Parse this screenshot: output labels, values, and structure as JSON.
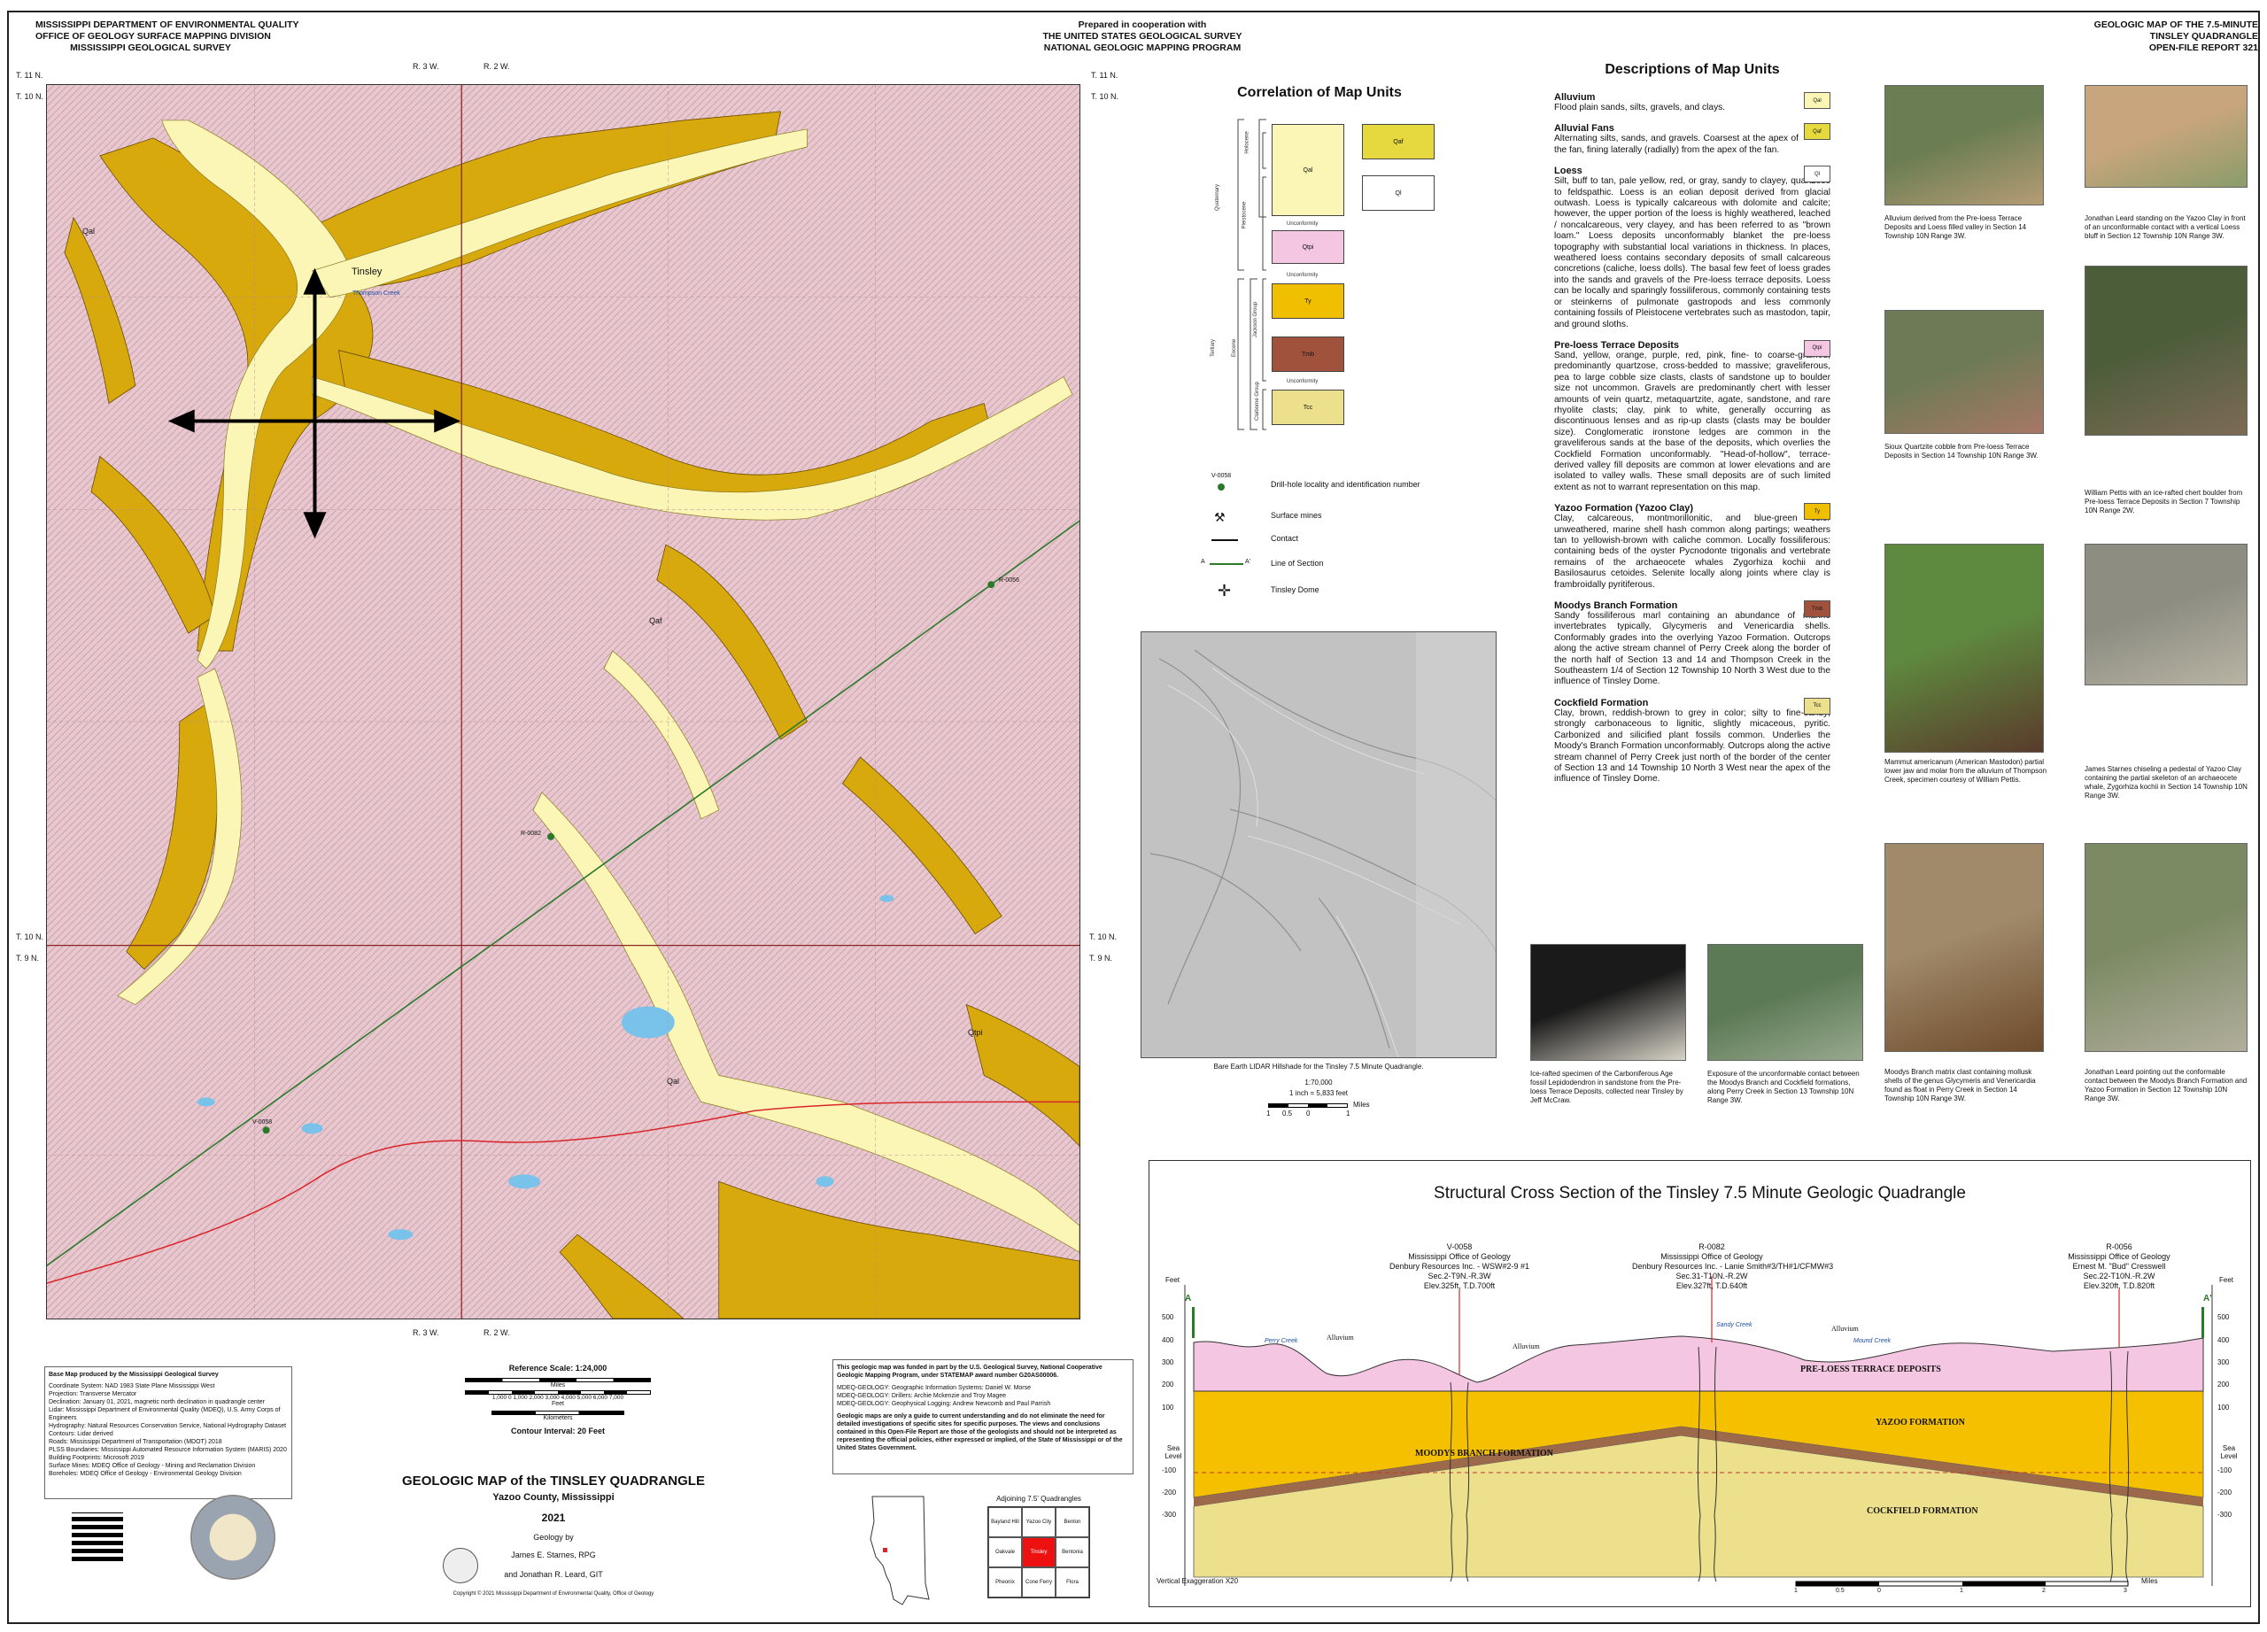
{
  "header": {
    "left": [
      "MISSISSIPPI DEPARTMENT OF ENVIRONMENTAL QUALITY",
      "OFFICE OF GEOLOGY    SURFACE MAPPING DIVISION",
      "MISSISSIPPI GEOLOGICAL SURVEY"
    ],
    "middle": [
      "Prepared in cooperation with",
      "THE UNITED STATES GEOLOGICAL SURVEY",
      "NATIONAL GEOLOGIC MAPPING PROGRAM"
    ],
    "right": [
      "GEOLOGIC MAP OF THE 7.5-MINUTE",
      "TINSLEY QUADRANGLE",
      "OPEN-FILE REPORT 321"
    ]
  },
  "map": {
    "township_labels": {
      "t11_left": "T. 11 N.",
      "t10_left": "T. 10 N.",
      "t11_right": "T. 11 N.",
      "t10_right": "T. 10 N.",
      "t10_mid_left": "T. 10 N.",
      "t9_mid_left": "T. 9 N.",
      "t10_mid_right": "T. 10 N.",
      "t9_mid_right": "T. 9 N."
    },
    "range_labels": {
      "r3_top": "R. 3 W.",
      "r2_top": "R. 2 W.",
      "r3_bottom": "R. 3 W.",
      "r2_bottom": "R. 2 W."
    },
    "place": "Tinsley",
    "creek": "Thompson Creek",
    "unit_labels": {
      "qal": "Qal",
      "qaf": "Qaf",
      "qtpi": "Qtpi"
    },
    "wells": {
      "w1": "V-0058",
      "w2": "R-0082",
      "w3": "R-0056"
    },
    "colors": {
      "loess": "#e8c7cf",
      "alluvium": "#fbf6b6",
      "terrace": "#d8a90c",
      "road": "#d9262a",
      "section_line": "#2a7a2a",
      "grid": "#8b2626"
    }
  },
  "correlation": {
    "title": "Correlation of Map Units",
    "boxes": {
      "qal": "Qal",
      "qaf": "Qaf",
      "ql": "Ql",
      "qtpi": "Qtpi",
      "ty": "Ty",
      "tmb": "Tmb",
      "tcc": "Tcc"
    },
    "unconformity": "Unconformity",
    "ages": {
      "holocene": "Holocene",
      "pleistocene": "Pleistocene",
      "quaternary": "Quaternary",
      "tertiary": "Tertiary",
      "eocene": "Eocene",
      "jackson": "Jackson Group",
      "claiborne": "Claiborne Group"
    },
    "legend": {
      "well_id": "V-0058",
      "drill": "Drill-hole locality and identification number",
      "mines": "Surface mines",
      "contact": "Contact",
      "section": "Line of Section",
      "dome": "Tinsley Dome",
      "a": "A",
      "a_prime": "A'"
    },
    "colors": {
      "qal": "#fbf6b6",
      "qaf": "#e6d83f",
      "ql": "#ffffff",
      "qtpi": "#f5c6e1",
      "ty": "#f0c000",
      "tmb": "#a0523d",
      "tcc": "#ece08c"
    }
  },
  "lidar": {
    "caption": "Bare Earth LIDAR Hillshade for the Tinsley 7.5 Minute Quadrangle.",
    "scale_ratio": "1:70,000",
    "scale_inch": "1 inch = 5,833 feet",
    "scale_ticks": [
      "1",
      "0.5",
      "0",
      "1"
    ],
    "scale_unit": "Miles"
  },
  "descriptions": {
    "title": "Descriptions of Map Units",
    "units": [
      {
        "name": "Alluvium",
        "sym": "Qal",
        "color": "#fbf6b6",
        "text": "Flood plain sands, silts, gravels, and clays."
      },
      {
        "name": "Alluvial Fans",
        "sym": "Qaf",
        "color": "#e6d83f",
        "text": "Alternating silts, sands, and gravels.  Coarsest at the apex of the fan, fining laterally (radially) from the apex of the fan."
      },
      {
        "name": "Loess",
        "sym": "Ql",
        "color": "#ffffff",
        "text": "Silt, buff to tan, pale yellow, red, or gray, sandy to clayey, quartzose to feldspathic.  Loess is an eolian deposit derived from glacial outwash.  Loess is typically calcareous with dolomite and calcite; however, the upper portion of the loess is highly weathered, leached / noncalcareous, very clayey, and has been referred to as \"brown loam.\"  Loess deposits unconformably blanket the pre-loess topography with substantial local variations in thickness.  In places, weathered loess contains secondary deposits of small calcareous concretions (caliche, loess dolls).  The basal few feet of loess grades into the sands and gravels of the Pre-loess terrace deposits.  Loess can be locally and sparingly fossiliferous, commonly containing tests or steinkerns of pulmonate gastropods and less commonly containing fossils of Pleistocene vertebrates such as mastodon, tapir, and ground sloths."
      },
      {
        "name": "Pre-loess Terrace Deposits",
        "sym": "Qtpi",
        "color": "#f5c6e1",
        "text": "Sand, yellow, orange, purple, red, pink, fine- to coarse-grained, predominantly quartzose, cross-bedded to massive; graveliferous, pea to large cobble size clasts, clasts of sandstone up to boulder size not uncommon. Gravels are predominantly chert with lesser amounts of vein quartz, metaquartzite, agate, sandstone, and rare rhyolite clasts; clay, pink to white, generally occurring as discontinuous lenses and as rip-up clasts (clasts may be boulder size). Conglomeratic ironstone ledges are common in the graveliferous sands at the base of the deposits, which overlies the Cockfield Formation unconformably. \"Head-of-hollow\", terrace-derived valley fill deposits are common at lower elevations and are isolated to valley walls.  These small deposits are of such limited extent as not to warrant representation on this map."
      },
      {
        "name": "Yazoo Formation (Yazoo Clay)",
        "sym": "Ty",
        "color": "#f0c000",
        "text": "Clay, calcareous, montmorillonitic, and blue-green color unweathered, marine shell hash common along partings; weathers tan to yellowish-brown with caliche common. Locally fossiliferous: containing beds of the oyster Pycnodonte trigonalis and vertebrate remains of the archaeocete whales Zygorhiza kochii and Basilosaurus cetoides.  Selenite locally along joints where clay is frambroidally pyritiferous."
      },
      {
        "name": "Moodys Branch Formation",
        "sym": "Tmb",
        "color": "#a0523d",
        "text": "Sandy fossiliferous marl containing an abundance of marine invertebrates typically, Glycymeris and Venericardia shells. Conformably grades into the overlying Yazoo Formation. Outcrops along the active stream channel of Perry Creek along the border of the north half of Section 13 and 14 and Thompson Creek in the Southeastern 1/4 of Section 12 Township 10 North 3 West due to the influence of Tinsley Dome."
      },
      {
        "name": "Cockfield Formation",
        "sym": "Tcc",
        "color": "#ece08c",
        "text": "Clay, brown, reddish-brown to grey in color; silty to fine-sandy; strongly carbonaceous to lignitic, slightly micaceous, pyritic.  Carbonized and silicified plant fossils common. Underlies the Moody's Branch Formation unconformably. Outcrops along the active stream channel of Perry Creek just north of the border of the center of Section 13 and 14 Township 10 North 3 West near the apex of the influence of Tinsley Dome."
      }
    ]
  },
  "photos": [
    {
      "caption": "Alluvium derived from the Pre-loess Terrace Deposits and Loess filled valley in Section 14 Township 10N Range 3W.",
      "colors": [
        "#6b7d52",
        "#b59c75"
      ]
    },
    {
      "caption": "Jonathan Leard standing on the Yazoo Clay in front of an unconformable contact with a vertical Loess bluff in Section 12 Township 10N Range 3W.",
      "colors": [
        "#c9a57d",
        "#8a9c6a"
      ]
    },
    {
      "caption": "Sioux Quartzite cobble from Pre-loess Terrace Deposits in Section 14 Township 10N Range 3W.",
      "colors": [
        "#6d7a55",
        "#a77866"
      ]
    },
    {
      "caption": "William Pettis with an ice-rafted chert boulder from Pre-loess Terrace Deposits in Section 7 Township 10N Range 2W.",
      "colors": [
        "#4c5d3a",
        "#7d6b55"
      ]
    },
    {
      "caption": "Mammut americanum (American Mastodon) partial lower jaw and molar from the alluvium of Thompson Creek, specimen courtesy of William Pettis.",
      "colors": [
        "#5e8a3f",
        "#5a3b2b"
      ]
    },
    {
      "caption": "James Starnes chiseling a pedestal of Yazoo Clay containing the partial skeleton of an archaeocete whale, Zygorhiza kochii in Section 14 Township 10N Range 3W.",
      "colors": [
        "#8d8d82",
        "#b8b4a4"
      ]
    },
    {
      "caption": "Moodys Branch matrix clast containing mollusk shells of the genus Glycymeris and Venericardia found as float in Perry Creek in Section 14 Township 10N Range 3W.",
      "colors": [
        "#a08a6a",
        "#6e4b2c"
      ]
    },
    {
      "caption": "Jonathan Leard pointing out the conformable contact between the Moodys Branch Formation and Yazoo Formation in Section 12 Township 10N Range 3W.",
      "colors": [
        "#7c8a64",
        "#b1ae9c"
      ]
    },
    {
      "caption": "Ice-rafted specimen of the Carboniferous Age fossil Lepidodendron in sandstone from the Pre-loess Terrace Deposits, collected near Tinsley by Jeff McCraw.",
      "colors": [
        "#1a1a1a",
        "#d8d4c8"
      ]
    },
    {
      "caption": "Exposure of the unconformable contact between the Moodys Branch and Cockfield formations, along Perry Creek in Section 13 Township 10N Range 3W.",
      "colors": [
        "#5c7a55",
        "#98a98e"
      ]
    }
  ],
  "cross_section": {
    "title": "Structural Cross Section of the Tinsley 7.5 Minute Geologic Quadrangle",
    "wells": [
      {
        "id": "V-0058",
        "org": "Mississippi Office of Geology",
        "op": "Denbury Resources Inc. - WSW#2-9 #1",
        "loc": "Sec.2-T9N.-R.3W",
        "elev": "Elev.325ft, T.D.700ft"
      },
      {
        "id": "R-0082",
        "org": "Mississippi Office of Geology",
        "op": "Denbury Resources Inc. - Lanie Smith#3/TH#1/CFMW#3",
        "loc": "Sec.31-T10N.-R.2W",
        "elev": "Elev.327ft, T.D.640ft"
      },
      {
        "id": "R-0056",
        "org": "Mississippi Office of Geology",
        "op": "Ernest M. \"Bud\" Cresswell",
        "loc": "Sec.22-T10N.-R.2W",
        "elev": "Elev.320ft, T.D.820ft"
      }
    ],
    "units": {
      "pre_loess": "PRE-LOESS TERRACE DEPOSITS",
      "yazoo": "YAZOO FORMATION",
      "moodys": "MOODYS BRANCH FORMATION",
      "cockfield": "COCKFIELD FORMATION"
    },
    "surface_labels": {
      "alluvium": "Alluvium",
      "perry": "Perry Creek",
      "sandy": "Sandy Creek",
      "mound": "Mound Creek"
    },
    "axis_unit": "Feet",
    "y_ticks": [
      "500",
      "400",
      "300",
      "200",
      "100",
      "Sea Level",
      "-100",
      "-200",
      "-300"
    ],
    "a": "A",
    "a_prime": "A'",
    "exaggeration": "Vertical Exaggeration X20",
    "scale_ticks": [
      "1",
      "0.5",
      "0",
      "1",
      "2",
      "3"
    ],
    "scale_unit": "Miles",
    "colors": {
      "pre_loess": "#f5c6e1",
      "yazoo": "#f5c000",
      "moodys": "#9c6a4a",
      "cockfield": "#ece08c"
    }
  },
  "basemap": {
    "title": "Base Map produced by the Mississippi Geological Survey",
    "lines": [
      "Coordinate System: NAD 1983 State Plane Mississippi West",
      "Projection: Transverse Mercator",
      "Declination: January 01, 2021, magnetic north declination in quadrangle center",
      "Lidar: Mississippi Department of Environmental Quality (MDEQ), U.S. Army Corps of Engineers",
      "Hydrography: Natural Resources Conservation Service, National Hydrography Dataset",
      "Contours: Lidar derived",
      "Roads: Mississippi Department of Transportation (MDOT) 2018",
      "PLSS Boundaries: Mississippi Automated Resource Information System (MARIS) 2020",
      "Building Footprints: Microsoft 2019",
      "Surface Mines: MDEQ Office of Geology - Mining and Reclamation Division",
      "Boreholes: MDEQ Office of Geology - Environmental Geology Division"
    ]
  },
  "scale": {
    "title": "Reference Scale: 1:24,000",
    "miles": "Miles",
    "feet": "Feet",
    "km": "Kilometers",
    "feet_ticks": "1,000  0  1,000  2,000  3,000  4,000  5,000  6,000  7,000",
    "contour": "Contour Interval:   20 Feet"
  },
  "title_block": {
    "title": "GEOLOGIC MAP of the TINSLEY QUADRANGLE",
    "county": "Yazoo County,  Mississippi",
    "year": "2021",
    "by": "Geology by",
    "author1": "James E. Starnes, RPG",
    "author2": "and Jonathan R. Leard, GIT",
    "copyright": "Copyright © 2021 Mississippi Department of Environmental Quality, Office of Geology"
  },
  "funding": {
    "p1": "This geologic map was funded in part by the U.S. Geological Survey, National Cooperative Geologic Mapping Program, under STATEMAP award number G20AS00006.",
    "credits": [
      "MDEQ-GEOLOGY: Geographic Information Systems: Daniel W. Morse",
      "MDEQ-GEOLOGY: Drillers: Archie Mckenzie and Troy Magee",
      "MDEQ-GEOLOGY: Geophysical Logging: Andrew Newcomb and Paul Parrish"
    ],
    "p2": "Geologic maps are only a guide to current understanding and do not eliminate the need for detailed investigations of specific sites for specific purposes. The views and conclusions contained in this Open-File Report are those of the geologists and should not be interpreted as representing the official policies, either expressed or implied, of the State of Mississippi or of the United States Government."
  },
  "adjoining": {
    "title": "Adjoining 7.5' Quadrangles",
    "cells": [
      "Bayland Hill",
      "Yazoo City",
      "Benton",
      "Oakvale",
      "Tinsley",
      "Bentonia",
      "Pheonix",
      "Cone Ferry",
      "Flora"
    ]
  }
}
